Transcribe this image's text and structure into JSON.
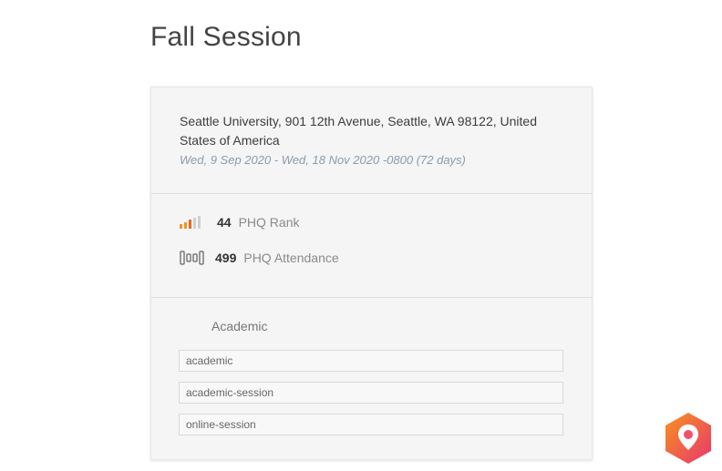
{
  "page": {
    "title": "Fall Session"
  },
  "event": {
    "address": "Seattle University, 901 12th Avenue, Seattle, WA 98122, United States of America",
    "dates": "Wed, 9 Sep 2020 - Wed, 18 Nov 2020 -0800 (72 days)"
  },
  "stats": {
    "rank": {
      "value": "44",
      "label": "PHQ Rank",
      "icon": "signal-bars-icon",
      "level_fraction": 0.6
    },
    "attendance": {
      "value": "499",
      "label": "PHQ Attendance",
      "icon": "people-icon"
    }
  },
  "labels": {
    "heading": "Academic",
    "items": [
      "academic",
      "academic-session",
      "online-session"
    ]
  },
  "colors": {
    "accent_orange": "#f7931e",
    "accent_pink": "#e8366f",
    "muted_blue": "#8a9bad",
    "card_background": "#f5f5f5"
  },
  "brand": {
    "logo_icon": "predicthq-pin-logo-icon"
  }
}
